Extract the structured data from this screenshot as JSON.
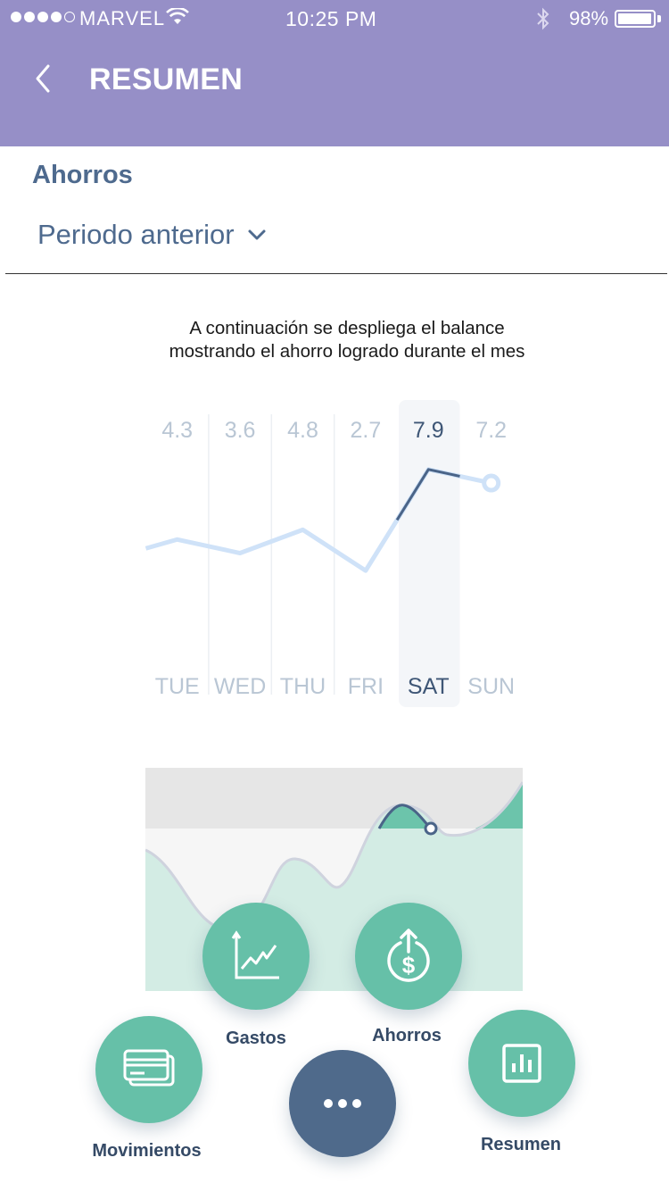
{
  "status_bar": {
    "carrier": "MARVEL",
    "time": "10:25 PM",
    "battery": "98%",
    "battery_level": 0.98
  },
  "header": {
    "title": "RESUMEN"
  },
  "section": {
    "title": "Ahorros",
    "period_selector": "Periodo anterior"
  },
  "description": {
    "line1": "A continuación se despliega el balance",
    "line2": "mostrando el ahorro logrado durante el mes"
  },
  "chart_data": {
    "type": "line",
    "categories": [
      "TUE",
      "WED",
      "THU",
      "FRI",
      "SAT",
      "SUN"
    ],
    "values": [
      4.3,
      3.6,
      4.8,
      2.7,
      7.9,
      7.2
    ],
    "value_labels": [
      "4.3",
      "3.6",
      "4.8",
      "2.7",
      "7.9",
      "7.2"
    ],
    "highlighted": "SAT",
    "colors": {
      "line": "#cfe2f8",
      "highlight_line": "#4a6488",
      "active_text": "#3e5676",
      "inactive_text": "#b9c6d4",
      "highlight_bg": "#f4f6f9"
    }
  },
  "area_chart": {
    "colors": {
      "fill": "#d3ece4",
      "accent": "#6cc4ab",
      "band": "#e6e6e6",
      "line": "#cfd3de",
      "highlight_line": "#4a6488"
    }
  },
  "actions": [
    {
      "label": "Movimientos",
      "icon": "cards-icon"
    },
    {
      "label": "Gastos",
      "icon": "chart-line-icon"
    },
    {
      "label": "Ahorros",
      "icon": "dollar-coin-icon"
    },
    {
      "label": "Resumen",
      "icon": "bar-chart-icon"
    },
    {
      "label": "",
      "icon": "more-icon"
    }
  ]
}
